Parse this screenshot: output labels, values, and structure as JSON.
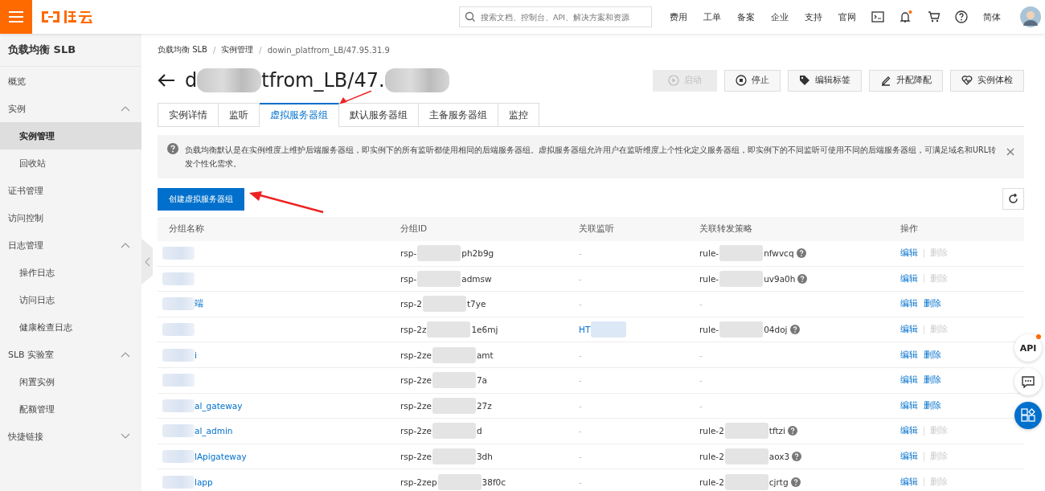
{
  "topbar": {
    "search_placeholder": "搜索文档、控制台、API、解决方案和资源",
    "links": [
      "费用",
      "工单",
      "备案",
      "企业",
      "支持",
      "官网"
    ],
    "notification_dot": true,
    "language": "简体"
  },
  "sidebar": {
    "title": "负载均衡 SLB",
    "items": [
      {
        "label": "概览",
        "selected": false
      },
      {
        "label": "实例",
        "selected": false,
        "expanded": true,
        "children": [
          {
            "label": "实例管理",
            "selected": true
          },
          {
            "label": "回收站",
            "selected": false
          }
        ]
      },
      {
        "label": "证书管理",
        "selected": false
      },
      {
        "label": "访问控制",
        "selected": false
      },
      {
        "label": "日志管理",
        "selected": false,
        "expanded": true,
        "children": [
          {
            "label": "操作日志",
            "selected": false
          },
          {
            "label": "访问日志",
            "selected": false
          },
          {
            "label": "健康检查日志",
            "selected": false
          }
        ]
      },
      {
        "label": "SLB 实验室",
        "selected": false,
        "expanded": true,
        "children": [
          {
            "label": "闲置实例",
            "selected": false
          },
          {
            "label": "配额管理",
            "selected": false
          }
        ]
      },
      {
        "label": "快捷链接",
        "selected": false,
        "expanded": false
      }
    ]
  },
  "breadcrumb": {
    "separator": "/",
    "items": [
      "负载均衡 SLB",
      "实例管理",
      "dowin_platfrom_LB/47.95.31.9"
    ]
  },
  "title": {
    "start": "d",
    "middle": "tfrom_LB/47."
  },
  "actions": [
    {
      "label": "启动",
      "disabled": true
    },
    {
      "label": "停止",
      "disabled": false
    },
    {
      "label": "编辑标签",
      "disabled": false
    },
    {
      "label": "升配降配",
      "disabled": false
    },
    {
      "label": "实例体检",
      "disabled": false
    }
  ],
  "tabs": [
    {
      "label": "实例详情",
      "selected": false
    },
    {
      "label": "监听",
      "selected": false
    },
    {
      "label": "虚拟服务器组",
      "selected": true
    },
    {
      "label": "默认服务器组",
      "selected": false
    },
    {
      "label": "主备服务器组",
      "selected": false
    },
    {
      "label": "监控",
      "selected": false
    }
  ],
  "notice": {
    "text": "负载均衡默认是在实例维度上维护后端服务器组，即实例下的所有监听都使用相同的后端服务器组。虚拟服务器组允许用户在监听维度上个性化定义服务器组，即实例下的不同监听可使用不同的后端服务器组，可满足域名和URL转发个性化需求。"
  },
  "create_button": "创建虚拟服务器组",
  "table": {
    "columns": [
      "分组名称",
      "分组ID",
      "关联监听",
      "关联转发策略",
      "操作"
    ],
    "rows": [
      {
        "id": [
          "rsp-",
          "ph2b9g"
        ],
        "listener": [
          "-"
        ],
        "rule": [
          "rule-",
          "nfwvcq"
        ],
        "edit": "编辑",
        "delete": "删除",
        "delete_disabled": true
      },
      {
        "id": [
          "rsp-",
          "admsw"
        ],
        "listener": [
          "-"
        ],
        "rule": [
          "rule-",
          "uv9a0h"
        ],
        "edit": "编辑",
        "delete": "删除",
        "delete_disabled": true
      },
      {
        "name": "端",
        "id": [
          "rsp-2",
          "t7ye"
        ],
        "listener": [
          "-"
        ],
        "rule": [
          "-"
        ],
        "edit": "编辑",
        "delete": "删除",
        "delete_disabled": false
      },
      {
        "id": [
          "rsp-2z",
          "1e6mj"
        ],
        "listener": [
          "HT"
        ],
        "listener_redacted": true,
        "rule": [
          "rule-",
          "04doj"
        ],
        "edit": "编辑",
        "delete": "删除",
        "delete_disabled": true
      },
      {
        "name": "i",
        "id": [
          "rsp-2ze",
          "amt"
        ],
        "listener": [
          "-"
        ],
        "rule": [
          "-"
        ],
        "edit": "编辑",
        "delete": "删除",
        "delete_disabled": false
      },
      {
        "id": [
          "rsp-2ze",
          "7a"
        ],
        "listener": [
          "-"
        ],
        "rule": [
          "-"
        ],
        "edit": "编辑",
        "delete": "删除",
        "delete_disabled": false
      },
      {
        "name": "al_gateway",
        "id": [
          "rsp-2ze",
          "27z"
        ],
        "listener": [
          "-"
        ],
        "rule": [
          "-"
        ],
        "edit": "编辑",
        "delete": "删除",
        "delete_disabled": false
      },
      {
        "name": "al_admin",
        "id": [
          "rsp-2ze",
          "d"
        ],
        "listener": [
          "-"
        ],
        "rule": [
          "rule-2",
          "tftzi"
        ],
        "edit": "编辑",
        "delete": "删除",
        "delete_disabled": true
      },
      {
        "name": "lApigateway",
        "id": [
          "rsp-2ze",
          "3dh"
        ],
        "listener": [
          "-"
        ],
        "rule": [
          "rule-2",
          "aox3"
        ],
        "edit": "编辑",
        "delete": "删除",
        "delete_disabled": true
      },
      {
        "name": "lapp",
        "id": [
          "rsp-2zep",
          "38f0c"
        ],
        "listener": [
          "-"
        ],
        "rule": [
          "rule-2",
          "cjrtg"
        ],
        "edit": "编辑",
        "delete": "删除",
        "delete_disabled": true
      }
    ]
  },
  "float_buttons": [
    {
      "kind": "api",
      "label": "API",
      "dot": true
    },
    {
      "kind": "chat"
    },
    {
      "kind": "apps"
    }
  ]
}
